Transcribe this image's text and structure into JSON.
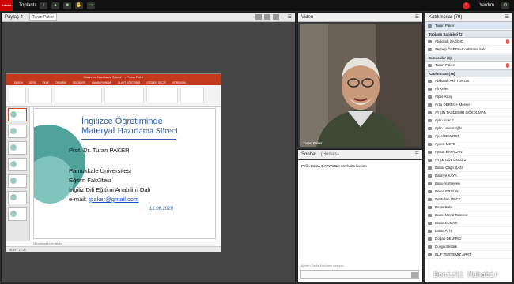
{
  "topbar": {
    "logo": "Adobe",
    "meeting_menu": "Toplantı",
    "help": "Yardım",
    "alert_count": "!"
  },
  "share": {
    "title": "Paylaş 4",
    "presenter": "Turan Paker"
  },
  "ppt": {
    "window_title": "Materyal Hazırlama Süreci 1 - PowerPoint",
    "tabs": [
      "DOSYA",
      "GİRİŞ",
      "EKLE",
      "TASARIM",
      "GEÇİŞLER",
      "ANİMASYONLAR",
      "SLAYT GÖSTERİSİ",
      "GÖZDEN GEÇİR",
      "GÖRÜNÜM"
    ],
    "status": "SLAYT 1 / 20",
    "notes": "Not eklemek için tıklatın",
    "slide": {
      "title1": "İngilizce Öğretiminde",
      "title2a": "Materyal",
      "title2b": "Hazırlama Süreci",
      "author": "Prof. Dr. Turan PAKER",
      "uni": "Pamukkale Üniversitesi",
      "faculty": "Eğitim Fakültesi",
      "dept": "İngiliz Dili Eğitimi Anabilim Dalı",
      "email_label": "e-mail:",
      "email": "tpaker@gmail.com",
      "date": "12.06.2020"
    }
  },
  "video": {
    "title": "Video",
    "caption": "Turan Paker"
  },
  "chat": {
    "title": "Sohbet",
    "scope": "(Herkes)",
    "message_sender": "Pelin Esma ÇAYVARLI:",
    "message_text": "Merhaba hocam",
    "input_hint": "Birden Fazla Katılımcı yazıyor...",
    "placeholder": ""
  },
  "participants": {
    "title": "Katılımcılar",
    "count": "(79)",
    "self": "Turan Paker",
    "hosts_header": "Toplantı Sahipleri (2)",
    "hosts": [
      "Abdullah SAĞDIÇ",
      "Zeynep ÖZBEK+Konferans Salo..."
    ],
    "presenters_header": "Sunucular (1)",
    "presenters": [
      "Turan Paker"
    ],
    "attendees_header": "Katılımcılar (76)",
    "attendees": [
      "Abdullah Akif TOROS",
      "Ali Keleş",
      "Alper Alkış",
      "Arzu DEREĞİ- Mersin",
      "AYŞİN TAŞDEMİR GÖKDUMAN",
      "Aylin Acar 2",
      "Aylin Levent oğlu",
      "Aysel DEMRET",
      "Ayşen METE",
      "Aysun KAYACAN",
      "AYŞE GÜL ÜNLÜ 2",
      "Bahar Çağrı ŞAN",
      "Bahriye KAYA",
      "Banu Yurtseven",
      "Berna ERGÜN",
      "Beytullah ÖNCE",
      "Beçin Balcı",
      "Burcu Meral Tozeren",
      "Büşra ELMAS",
      "Davut ATİŞ",
      "Doğan DEMİRCİ",
      "Duygu Ekitürk",
      "ELİF TERTEMİZ ARAT"
    ]
  },
  "watermark": "Denizli Muhabir"
}
